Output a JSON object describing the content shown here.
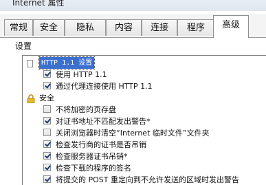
{
  "window": {
    "title": "Internet 属性"
  },
  "tabs": [
    {
      "label": "常规"
    },
    {
      "label": "安全"
    },
    {
      "label": "隐私"
    },
    {
      "label": "内容"
    },
    {
      "label": "连接"
    },
    {
      "label": "程序"
    },
    {
      "label": "高级",
      "active": true
    }
  ],
  "settings": {
    "label": "设置",
    "groups": [
      {
        "title": "HTTP 1.1 设置",
        "icon": "page-icon",
        "items": [
          {
            "label": "使用 HTTP 1.1",
            "checked": true
          },
          {
            "label": "通过代理连接使用 HTTP 1.1",
            "checked": true
          }
        ]
      },
      {
        "title": "安全",
        "icon": "lock-icon",
        "items": [
          {
            "label": "不将加密的页存盘",
            "checked": false
          },
          {
            "label": "对证书地址不匹配发出警告*",
            "checked": true
          },
          {
            "label": "关闭浏览器时清空“Internet 临时文件”文件夹",
            "checked": false
          },
          {
            "label": "检查发行商的证书是否吊销",
            "checked": true
          },
          {
            "label": "检查服务器证书吊销*",
            "checked": true
          },
          {
            "label": "检查下载的程序的签名",
            "checked": true
          },
          {
            "label": "将提交的 POST 重定向到不允许发送的区域时发出警告",
            "checked": true
          }
        ]
      }
    ]
  },
  "colors": {
    "selection": "#3b6fd0",
    "checkmark": "#1f3c73"
  }
}
